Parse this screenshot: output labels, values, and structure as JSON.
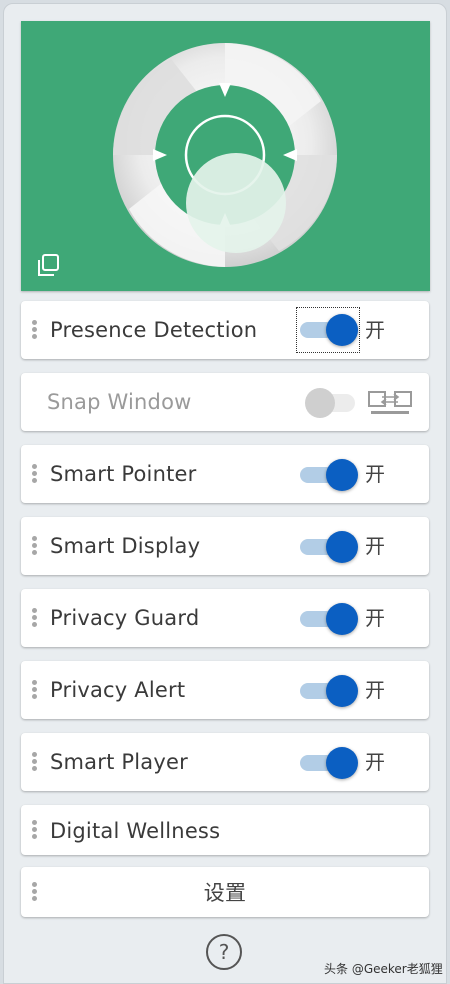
{
  "hero": {
    "background_color": "#3fa877",
    "logo_icon": "aperture-lens-logo",
    "corner_icon": "copy-window-icon"
  },
  "items": [
    {
      "label": "Presence Detection",
      "toggle_on": true,
      "state": "开",
      "focused": true
    },
    {
      "label": "Snap Window",
      "toggle_on": false,
      "disabled": true,
      "icon": "dual-monitor-icon"
    },
    {
      "label": "Smart Pointer",
      "toggle_on": true,
      "state": "开"
    },
    {
      "label": "Smart Display",
      "toggle_on": true,
      "state": "开"
    },
    {
      "label": "Privacy Guard",
      "toggle_on": true,
      "state": "开"
    },
    {
      "label": "Privacy Alert",
      "toggle_on": true,
      "state": "开"
    },
    {
      "label": "Smart Player",
      "toggle_on": true,
      "state": "开"
    },
    {
      "label": "Digital Wellness"
    },
    {
      "label": "设置"
    }
  ],
  "help": {
    "symbol": "?"
  },
  "watermark": "头条 @Geeker老狐狸",
  "colors": {
    "accent": "#0b5fc2",
    "track_on": "#b2cde6"
  }
}
